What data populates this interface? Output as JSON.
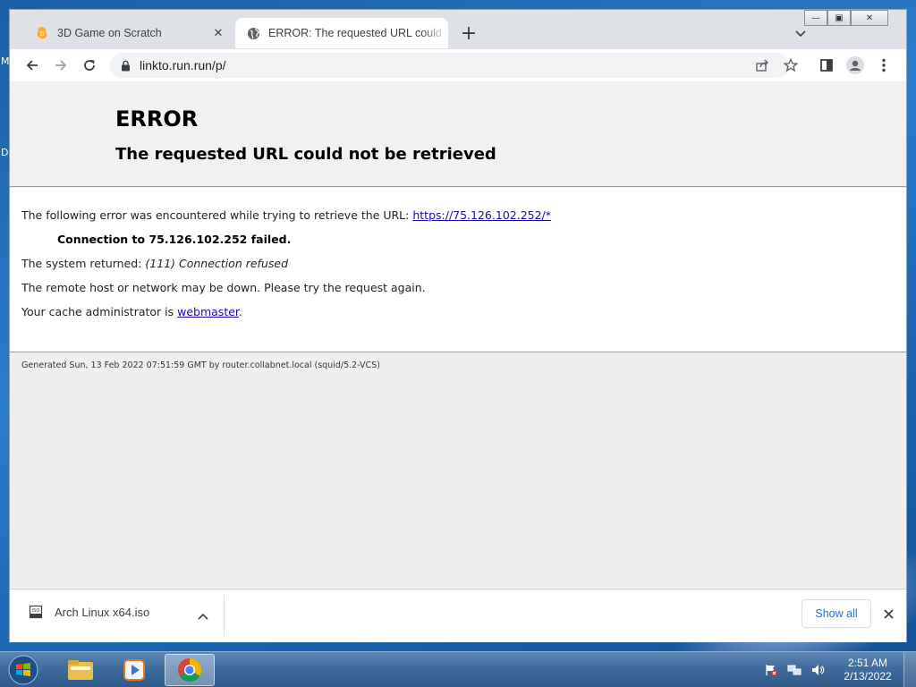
{
  "desktop": {
    "left_letters": [
      "M",
      "D"
    ]
  },
  "browser": {
    "tabs": [
      {
        "title": "3D Game on Scratch",
        "favicon": "scratch-icon",
        "active": false
      },
      {
        "title": "ERROR: The requested URL could not be retrieved",
        "favicon": "globe-icon",
        "active": true
      }
    ],
    "address": "linkto.run.run/p/",
    "window_controls": {
      "minimize": "minimize-icon",
      "maximize": "maximize-icon",
      "close": "close-icon"
    }
  },
  "page": {
    "heading": "ERROR",
    "subheading": "The requested URL could not be retrieved",
    "line1_text": "The following error was encountered while trying to retrieve the URL: ",
    "line1_link": "https://75.126.102.252/*",
    "line2": "Connection to 75.126.102.252 failed.",
    "line3_prefix": "The system returned: ",
    "line3_detail": "(111) Connection refused",
    "line4": "The remote host or network may be down. Please try the request again.",
    "line5_prefix": "Your cache administrator is ",
    "line5_link": "webmaster",
    "line5_suffix": ".",
    "footer": "Generated Sun, 13 Feb 2022 07:51:59 GMT by router.collabnet.local (squid/5.2-VCS)"
  },
  "downloads": {
    "file": "Arch Linux x64.iso",
    "show_all": "Show all"
  },
  "taskbar": {
    "apps": [
      "explorer-icon",
      "media-player-icon",
      "chrome-icon"
    ],
    "time": "2:51 AM",
    "date": "2/13/2022"
  },
  "colors": {
    "accent": "#1a73e8",
    "link": "#1a0dab",
    "taskbar": "#3f6c9e"
  }
}
